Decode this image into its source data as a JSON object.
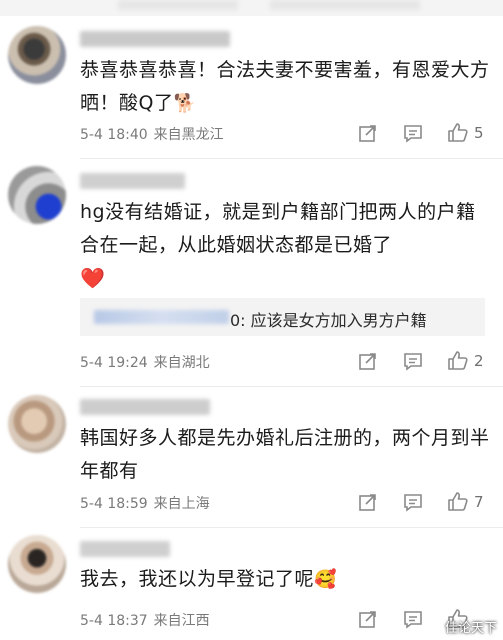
{
  "comments": [
    {
      "text": "恭喜恭喜恭喜！合法夫妻不要害羞，有恩爱大方晒！酸Q了",
      "emoji": "🐕",
      "time": "5-4 18:40",
      "location": "来自黑龙江",
      "likes": "5"
    },
    {
      "text": "hg没有结婚证，就是到户籍部门把两人的户籍合在一起，从此婚姻状态都是已婚了",
      "emoji": "❤️",
      "reply": "0: 应该是女方加入男方户籍",
      "time": "5-4 19:24",
      "location": "来自湖北",
      "likes": "2"
    },
    {
      "text": "韩国好多人都是先办婚礼后注册的，两个月到半年都有",
      "time": "5-4 18:59",
      "location": "来自上海",
      "likes": "7"
    },
    {
      "text": "我去，我还以为早登记了呢",
      "emoji": "🥰",
      "time": "5-4 18:37",
      "location": "来自江西",
      "likes": ""
    }
  ],
  "watermark": "佳论天下",
  "icons": {
    "share": "share-icon",
    "comment": "comment-icon",
    "like": "thumbs-up-icon"
  }
}
